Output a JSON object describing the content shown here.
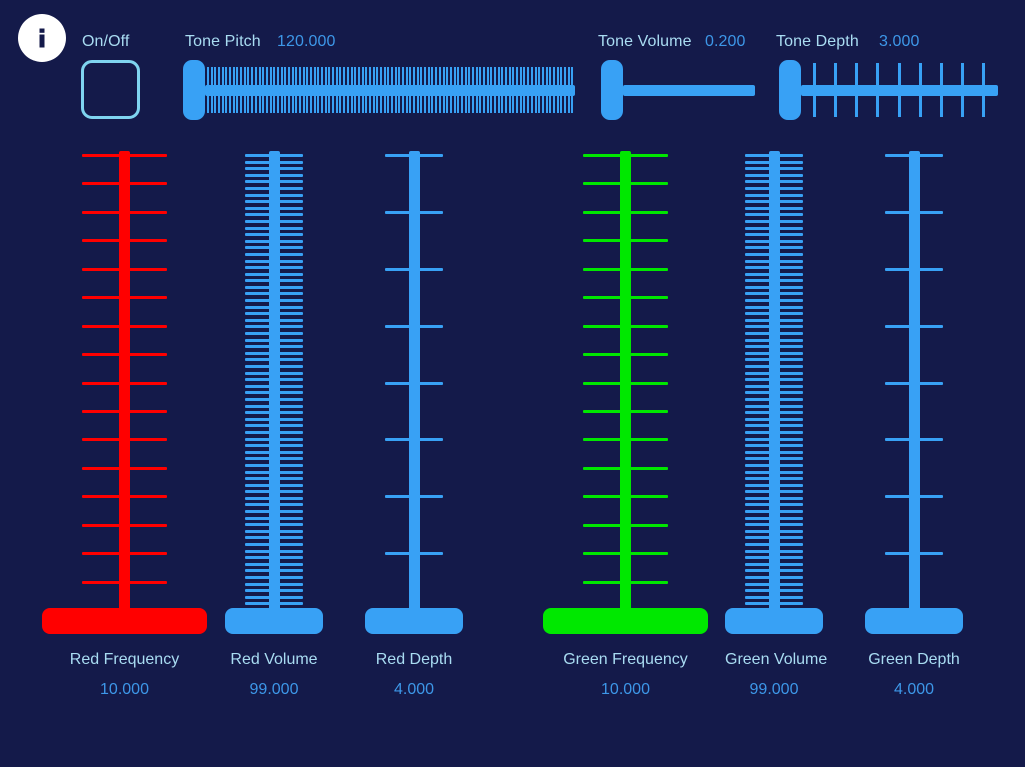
{
  "app": {
    "background_color": "#141a4a",
    "label_color": "#a9dcf2",
    "value_color": "#3d97e8",
    "accent_blue": "#38a1f5",
    "red": "#ff0000",
    "green": "#00e800"
  },
  "header": {
    "info_icon": "info-icon",
    "onoff": {
      "label": "On/Off",
      "checked": false
    },
    "tone_pitch": {
      "label": "Tone Pitch",
      "value": "120.000",
      "ticks": 100,
      "handle_position": "left"
    },
    "tone_volume": {
      "label": "Tone Volume",
      "value": "0.200",
      "ticks": 0,
      "handle_position": "left"
    },
    "tone_depth": {
      "label": "Tone Depth",
      "value": "3.000",
      "ticks": 9,
      "handle_position": "left"
    }
  },
  "sliders": [
    {
      "name": "red-frequency",
      "label": "Red Frequency",
      "value": "10.000",
      "color": "#ff0000",
      "ticks": 17,
      "tick_style": "wide",
      "handle_width": 165,
      "track_width": 11
    },
    {
      "name": "red-volume",
      "label": "Red Volume",
      "value": "99.000",
      "color": "#38a1f5",
      "ticks": 70,
      "tick_style": "dense",
      "handle_width": 98,
      "track_width": 11
    },
    {
      "name": "red-depth",
      "label": "Red Depth",
      "value": "4.000",
      "color": "#38a1f5",
      "ticks": 9,
      "tick_style": "sparse",
      "handle_width": 98,
      "track_width": 11
    },
    {
      "name": "green-frequency",
      "label": "Green Frequency",
      "value": "10.000",
      "color": "#00e800",
      "ticks": 17,
      "tick_style": "wide",
      "handle_width": 165,
      "track_width": 11
    },
    {
      "name": "green-volume",
      "label": "Green Volume",
      "value": "99.000",
      "color": "#38a1f5",
      "ticks": 70,
      "tick_style": "dense",
      "handle_width": 98,
      "track_width": 11
    },
    {
      "name": "green-depth",
      "label": "Green Depth",
      "value": "4.000",
      "color": "#38a1f5",
      "ticks": 9,
      "tick_style": "sparse",
      "handle_width": 98,
      "track_width": 11
    }
  ]
}
